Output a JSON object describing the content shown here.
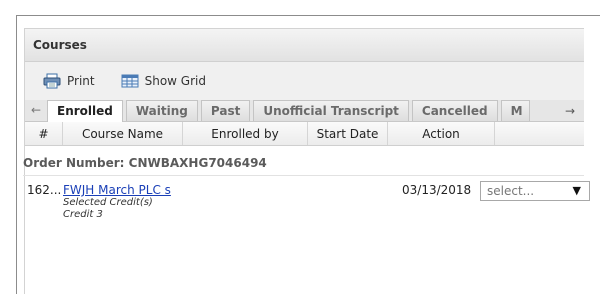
{
  "panel": {
    "title": "Courses"
  },
  "toolbar": {
    "print_label": "Print",
    "show_grid_label": "Show Grid"
  },
  "tabs": {
    "scroll_left": "←",
    "scroll_right": "→",
    "items": [
      {
        "label": "Enrolled",
        "active": true
      },
      {
        "label": "Waiting",
        "active": false
      },
      {
        "label": "Past",
        "active": false
      },
      {
        "label": "Unofficial Transcript",
        "active": false
      },
      {
        "label": "Cancelled",
        "active": false
      },
      {
        "label": "M",
        "active": false
      }
    ]
  },
  "grid": {
    "columns": [
      "#",
      "Course Name",
      "Enrolled by",
      "Start Date",
      "Action"
    ],
    "group": {
      "label": "Order Number: CNWBAXHG7046494"
    },
    "rows": [
      {
        "number": "162...",
        "course_name": "FWJH March PLC s",
        "detail_1": "Selected Credit(s)",
        "detail_2": "Credit 3",
        "enrolled_by": "",
        "start_date": "03/13/2018",
        "action_placeholder": "select..."
      }
    ]
  },
  "icons": {
    "print": "printer-icon",
    "grid": "grid-icon",
    "dropdown": "dropdown-arrow-icon"
  },
  "colors": {
    "link": "#1a3fb7",
    "header_bg": "#e2e2e2"
  }
}
